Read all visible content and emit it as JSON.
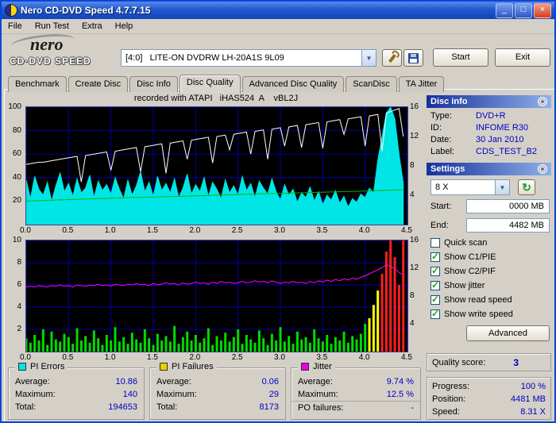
{
  "titlebar": {
    "title": "Nero CD-DVD Speed 4.7.7.15"
  },
  "icons": {
    "minimize": "_",
    "maximize": "□",
    "close": "×",
    "dropdown": "▼",
    "refresh": "↻"
  },
  "menubar": {
    "items": [
      "File",
      "Run Test",
      "Extra",
      "Help"
    ]
  },
  "logo": {
    "name": "nero",
    "subtitle": "CD·DVD SPEED"
  },
  "toolbar": {
    "drive": "[4:0]   LITE-ON DVDRW LH-20A1S 9L09",
    "start": "Start",
    "exit": "Exit"
  },
  "tabs": {
    "items": [
      "Benchmark",
      "Create Disc",
      "Disc Info",
      "Disc Quality",
      "Advanced Disc Quality",
      "ScanDisc",
      "TA Jitter"
    ],
    "active": "Disc Quality"
  },
  "chart_header": "recorded with ATAPI   iHAS524  A    vBL2J",
  "chart_data": [
    {
      "type": "area",
      "title": "PI Errors with read/write speed",
      "x_ticks": [
        "0.0",
        "0.5",
        "1.0",
        "1.5",
        "2.0",
        "2.5",
        "3.0",
        "3.5",
        "4.0",
        "4.5"
      ],
      "y_left_ticks": [
        "100",
        "80",
        "60",
        "40",
        "20"
      ],
      "y_right_ticks": [
        "16",
        "12",
        "8",
        "4"
      ],
      "ylim_left": [
        0,
        100
      ],
      "ylim_right": [
        0,
        16
      ],
      "x_data_frac": 0.989,
      "grid_color": "#0000A8",
      "bg": "#000000",
      "series": [
        {
          "name": "pi-errors",
          "type": "area",
          "color": "#00E5E5",
          "max": 100,
          "values": [
            38,
            22,
            41,
            30,
            25,
            36,
            20,
            33,
            44,
            28,
            35,
            24,
            39,
            27,
            31,
            42,
            23,
            37,
            29,
            34,
            26,
            40,
            30,
            22,
            38,
            25,
            33,
            45,
            28,
            36,
            24,
            41,
            29,
            35,
            27,
            39,
            23,
            31,
            43,
            26,
            34,
            28,
            40,
            24,
            36,
            30,
            22,
            38,
            27,
            33,
            25,
            41,
            29,
            35,
            23,
            37,
            31,
            26,
            39,
            28,
            21,
            34,
            25,
            30,
            19,
            27,
            23,
            32,
            20,
            28,
            17,
            25,
            21,
            29,
            18,
            24,
            15,
            22,
            19,
            26,
            23,
            31,
            27,
            55,
            75,
            95,
            100,
            90,
            60,
            35
          ]
        },
        {
          "name": "write-speed",
          "type": "line",
          "color": "#00B400",
          "max": 16,
          "width": 1,
          "values": [
            3.2,
            3.4,
            3.6,
            3.75,
            3.9,
            4.1,
            4.25,
            4.4,
            4.55,
            4.75
          ]
        },
        {
          "name": "read-speed",
          "type": "line",
          "color": "#FFFFFF",
          "max": 16,
          "width": 1,
          "values": [
            8.2,
            8.3,
            8.4,
            8.5,
            8.5,
            8.6,
            8.7,
            8.8,
            8.9,
            9.0,
            9.1,
            9.2,
            9.3,
            5.8,
            9.4,
            9.5,
            9.6,
            9.7,
            9.8,
            9.9,
            7.4,
            10.0,
            10.1,
            10.2,
            10.3,
            10.4,
            10.5,
            7.2,
            10.6,
            10.7,
            10.8,
            10.9,
            11.0,
            7.0,
            11.1,
            11.2,
            11.3,
            11.4,
            8.9,
            11.5,
            11.6,
            11.7,
            11.8,
            11.9,
            8.4,
            12.0,
            12.1,
            12.2,
            10.2,
            12.3,
            12.4,
            12.5,
            12.6,
            9.6,
            12.7,
            12.8,
            12.9,
            8.9,
            13.0,
            13.1,
            13.2,
            10.7,
            13.3,
            13.4,
            13.5,
            10.5,
            13.6,
            13.7,
            13.8,
            13.9,
            10.4,
            14.0,
            14.1,
            14.2,
            14.3,
            12.3,
            14.4,
            14.5,
            14.6,
            14.7,
            10.7,
            14.8,
            14.9,
            15.0,
            10.0,
            15.2,
            15.4,
            15.6,
            15.8,
            12.0
          ]
        }
      ]
    },
    {
      "type": "bar",
      "title": "PI Failures with jitter",
      "x_ticks": [
        "0.0",
        "0.5",
        "1.0",
        "1.5",
        "2.0",
        "2.5",
        "3.0",
        "3.5",
        "4.0",
        "4.5"
      ],
      "y_left_ticks": [
        "10",
        "8",
        "6",
        "4",
        "2"
      ],
      "y_right_ticks": [
        "16",
        "12",
        "8",
        "4"
      ],
      "ylim_left": [
        0,
        10
      ],
      "ylim_right": [
        0,
        16
      ],
      "x_data_frac": 0.989,
      "grid_color": "#0000A8",
      "bg": "#000000",
      "series": [
        {
          "name": "pi-failures",
          "type": "bars",
          "color": "#00DC00",
          "color_mid": "#FFFF00",
          "color_high": "#FF1E1E",
          "mid_at": 3,
          "high_at": 6,
          "max": 10,
          "values": [
            1.2,
            0.8,
            1.5,
            1.0,
            2.0,
            0.6,
            1.8,
            1.1,
            0.9,
            1.6,
            1.3,
            0.7,
            2.1,
            1.0,
            1.4,
            0.8,
            1.9,
            1.2,
            0.6,
            1.5,
            1.0,
            2.2,
            0.9,
            1.3,
            0.7,
            1.7,
            1.1,
            0.8,
            2.0,
            1.2,
            0.6,
            1.6,
            1.0,
            1.4,
            0.9,
            2.3,
            0.7,
            1.3,
            1.8,
            1.0,
            1.5,
            0.8,
            1.2,
            2.1,
            0.6,
            1.4,
            1.0,
            1.7,
            0.9,
            1.3,
            2.0,
            0.7,
            1.5,
            1.1,
            0.8,
            1.9,
            1.2,
            0.6,
            1.6,
            1.0,
            2.2,
            0.9,
            1.4,
            0.7,
            1.8,
            1.1,
            1.3,
            0.8,
            2.0,
            1.2,
            0.9,
            1.5,
            0.7,
            1.3,
            1.0,
            1.8,
            0.8,
            1.4,
            1.1,
            1.6,
            2.5,
            3.0,
            4.2,
            5.5,
            7.0,
            9.0,
            10.0,
            8.5,
            6.0,
            10.0
          ]
        },
        {
          "name": "jitter",
          "type": "line",
          "color": "#FF00FF",
          "max": 16,
          "width": 1,
          "values": [
            9.3,
            9.4,
            9.3,
            9.5,
            9.4,
            9.3,
            9.5,
            9.4,
            9.6,
            9.4,
            9.5,
            9.3,
            9.6,
            9.5,
            9.4,
            9.6,
            9.5,
            9.7,
            9.5,
            9.6,
            9.4,
            9.7,
            9.6,
            9.5,
            9.7,
            9.6,
            9.8,
            9.6,
            9.7,
            9.5,
            9.8,
            9.6,
            9.7,
            9.9,
            9.7,
            9.8,
            9.6,
            9.9,
            9.7,
            9.8,
            10.0,
            9.8,
            9.9,
            9.7,
            10.0,
            9.8,
            10.1,
            9.9,
            10.0,
            9.8,
            9.9,
            10.1,
            9.9,
            10.0,
            10.2,
            10.0,
            10.1,
            9.9,
            10.2,
            10.0,
            9.8,
            10.0,
            9.9,
            10.1,
            9.9,
            10.0,
            9.8,
            10.1,
            9.9,
            10.2,
            10.0,
            10.3,
            10.1,
            10.4,
            10.2,
            10.5,
            10.3,
            10.6,
            10.4,
            10.7,
            10.9,
            11.2,
            11.5,
            11.8,
            12.1,
            12.5,
            12.3,
            11.9,
            11.4,
            11.0
          ]
        }
      ]
    }
  ],
  "disc_info": {
    "title": "Disc info",
    "rows": [
      {
        "label": "Type:",
        "value": "DVD+R"
      },
      {
        "label": "ID:",
        "value": "INFOME R30"
      },
      {
        "label": "Date:",
        "value": "30 Jan 2010"
      },
      {
        "label": "Label:",
        "value": "CDS_TEST_B2"
      }
    ]
  },
  "settings": {
    "title": "Settings",
    "speed": "8 X",
    "start_label": "Start:",
    "start_value": "0000 MB",
    "end_label": "End:",
    "end_value": "4482 MB",
    "advanced": "Advanced",
    "checkboxes": [
      {
        "label": "Quick scan",
        "checked": false
      },
      {
        "label": "Show C1/PIE",
        "checked": true
      },
      {
        "label": "Show C2/PIF",
        "checked": true
      },
      {
        "label": "Show jitter",
        "checked": true
      },
      {
        "label": "Show read speed",
        "checked": true
      },
      {
        "label": "Show write speed",
        "checked": true
      }
    ]
  },
  "quality": {
    "label": "Quality score:",
    "value": "3"
  },
  "progress": {
    "rows": [
      {
        "label": "Progress:",
        "value": "100 %"
      },
      {
        "label": "Position:",
        "value": "4481 MB"
      },
      {
        "label": "Speed:",
        "value": "8.31 X"
      }
    ]
  },
  "stats": [
    {
      "title": "PI Errors",
      "color": "#00E5E5",
      "rows": [
        [
          "Average:",
          "10.86"
        ],
        [
          "Maximum:",
          "140"
        ],
        [
          "Total:",
          "194653"
        ]
      ]
    },
    {
      "title": "PI Failures",
      "color": "#E8D200",
      "rows": [
        [
          "Average:",
          "0.06"
        ],
        [
          "Maximum:",
          "29"
        ],
        [
          "Total:",
          "8173"
        ]
      ]
    },
    {
      "title": "Jitter",
      "color": "#E800E8",
      "rows": [
        [
          "Average:",
          "9.74 %"
        ],
        [
          "Maximum:",
          "12.5 %"
        ],
        [
          "PO failures:",
          "-"
        ]
      ]
    }
  ]
}
